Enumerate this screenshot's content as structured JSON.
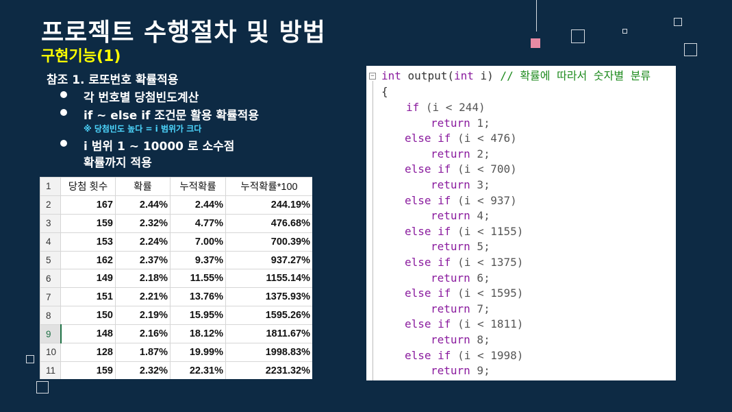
{
  "slide": {
    "title": "프로젝트 수행절차 및 방법",
    "subtitle": "구현기능(1)",
    "notes": {
      "heading": "참조  1.  로또번호  확률적용",
      "bullets": [
        "각  번호별  당첨빈도계산",
        "if  ~  else  if  조건문  활용  확률적용",
        "i  범위  1  ~  10000  로  소수점"
      ],
      "note_small": "※ 당첨빈도  높다  =  i  범위가  크다",
      "continuation": "확률까지  적용"
    }
  },
  "spreadsheet": {
    "headers": [
      "당첨 횟수",
      "확률",
      "누적확률",
      "누적확률*100"
    ],
    "rows": [
      {
        "row": "2",
        "count": "167",
        "prob": "2.44%",
        "cum": "2.44%",
        "cum100": "244.19%"
      },
      {
        "row": "3",
        "count": "159",
        "prob": "2.32%",
        "cum": "4.77%",
        "cum100": "476.68%"
      },
      {
        "row": "4",
        "count": "153",
        "prob": "2.24%",
        "cum": "7.00%",
        "cum100": "700.39%"
      },
      {
        "row": "5",
        "count": "162",
        "prob": "2.37%",
        "cum": "9.37%",
        "cum100": "937.27%"
      },
      {
        "row": "6",
        "count": "149",
        "prob": "2.18%",
        "cum": "11.55%",
        "cum100": "1155.14%"
      },
      {
        "row": "7",
        "count": "151",
        "prob": "2.21%",
        "cum": "13.76%",
        "cum100": "1375.93%"
      },
      {
        "row": "8",
        "count": "150",
        "prob": "2.19%",
        "cum": "15.95%",
        "cum100": "1595.26%"
      },
      {
        "row": "9",
        "count": "148",
        "prob": "2.16%",
        "cum": "18.12%",
        "cum100": "1811.67%"
      },
      {
        "row": "10",
        "count": "128",
        "prob": "1.87%",
        "cum": "19.99%",
        "cum100": "1998.83%"
      },
      {
        "row": "11",
        "count": "159",
        "prob": "2.32%",
        "cum": "22.31%",
        "cum100": "2231.32%"
      }
    ],
    "header_row": "1",
    "selected_row": "9"
  },
  "code": {
    "signature_kw": "int",
    "signature_name": "output(",
    "param_kw": "int",
    "param_rest": " i)",
    "comment": " // 확률에 따라서 숫자별 분류",
    "open_brace": "{",
    "branches": [
      {
        "kw": "if",
        "cond": " (i < 244)",
        "ret": "return",
        "val": " 1;"
      },
      {
        "kw": "else if",
        "cond": " (i < 476)",
        "ret": "return",
        "val": " 2;"
      },
      {
        "kw": "else if",
        "cond": " (i < 700)",
        "ret": "return",
        "val": " 3;"
      },
      {
        "kw": "else if",
        "cond": " (i < 937)",
        "ret": "return",
        "val": " 4;"
      },
      {
        "kw": "else if",
        "cond": " (i < 1155)",
        "ret": "return",
        "val": " 5;"
      },
      {
        "kw": "else if",
        "cond": " (i < 1375)",
        "ret": "return",
        "val": " 6;"
      },
      {
        "kw": "else if",
        "cond": " (i < 1595)",
        "ret": "return",
        "val": " 7;"
      },
      {
        "kw": "else if",
        "cond": " (i < 1811)",
        "ret": "return",
        "val": " 8;"
      },
      {
        "kw": "else if",
        "cond": " (i < 1998)",
        "ret": "return",
        "val": " 9;"
      }
    ],
    "fold_symbol": "−"
  }
}
